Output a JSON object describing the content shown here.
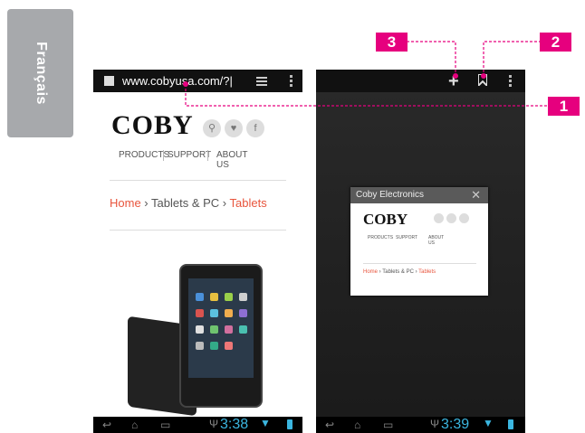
{
  "side_tab": {
    "label": "Français"
  },
  "left_screen": {
    "address_bar": {
      "url": "www.cobyusa.com/?|"
    },
    "page": {
      "logo": "COBY",
      "social_icons": [
        "search-icon",
        "twitter-icon",
        "facebook-icon"
      ],
      "nav": [
        "PRODUCTS",
        "SUPPORT",
        "ABOUT US"
      ],
      "breadcrumb": {
        "home": "Home",
        "sep1": " › ",
        "mid": "Tablets & PC",
        "sep2": " › ",
        "current": "Tablets"
      }
    },
    "system_bar": {
      "clock": "3:38"
    }
  },
  "right_screen": {
    "toolbar_icons": [
      "plus-icon",
      "bookmark-icon",
      "overflow-menu-icon"
    ],
    "tab_card": {
      "title": "Coby Electronics",
      "close": "✕",
      "logo": "COBY",
      "nav": [
        "PRODUCTS",
        "SUPPORT",
        "ABOUT US"
      ],
      "breadcrumb": {
        "home": "Home",
        "sep1": " › ",
        "mid": "Tablets & PC",
        "sep2": " › ",
        "current": "Tablets"
      }
    },
    "system_bar": {
      "clock": "3:39"
    }
  },
  "callouts": [
    {
      "number": "1"
    },
    {
      "number": "2"
    },
    {
      "number": "3"
    }
  ],
  "colors": {
    "callout": "#e6007e",
    "accent_link": "#e8553d",
    "clock": "#3bb6e0"
  }
}
